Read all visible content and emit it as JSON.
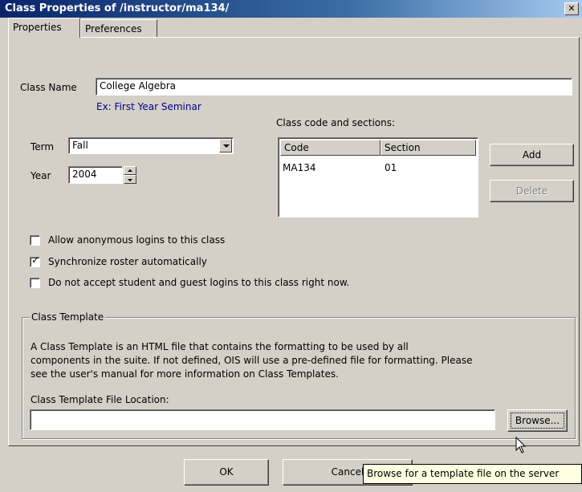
{
  "window": {
    "title": "Class Properties of /instructor/ma134/",
    "close_glyph": "✕"
  },
  "tabs": [
    {
      "label": "Properties"
    },
    {
      "label": "Preferences"
    }
  ],
  "class_name": {
    "label": "Class Name",
    "value": "College Algebra",
    "hint": "Ex: First Year Seminar"
  },
  "term": {
    "label": "Term",
    "value": "Fall"
  },
  "year": {
    "label": "Year",
    "value": "2004"
  },
  "codes": {
    "label": "Class code and sections:",
    "columns": [
      "Code",
      "Section"
    ],
    "rows": [
      {
        "code": "MA134",
        "section": "01"
      }
    ],
    "add_label": "Add",
    "delete_label": "Delete"
  },
  "options": [
    {
      "label": "Allow anonymous logins to this class",
      "checked": false
    },
    {
      "label": "Synchronize roster automatically",
      "checked": true
    },
    {
      "label": "Do not accept student and guest logins to this class right now.",
      "checked": false
    }
  ],
  "template": {
    "group_title": "Class Template",
    "description_lines": [
      "A Class Template is an HTML file that contains the formatting to be used by all",
      "components in the suite. If not defined, OIS will use a pre-defined file for formatting. Please",
      "see the user's manual for more information on Class Templates."
    ],
    "file_label": "Class Template File Location:",
    "file_value": "",
    "browse_label": "Browse..."
  },
  "tooltip": "Browse for a template file on the server",
  "footer": {
    "ok_label": "OK",
    "cancel_label": "Cancel"
  }
}
